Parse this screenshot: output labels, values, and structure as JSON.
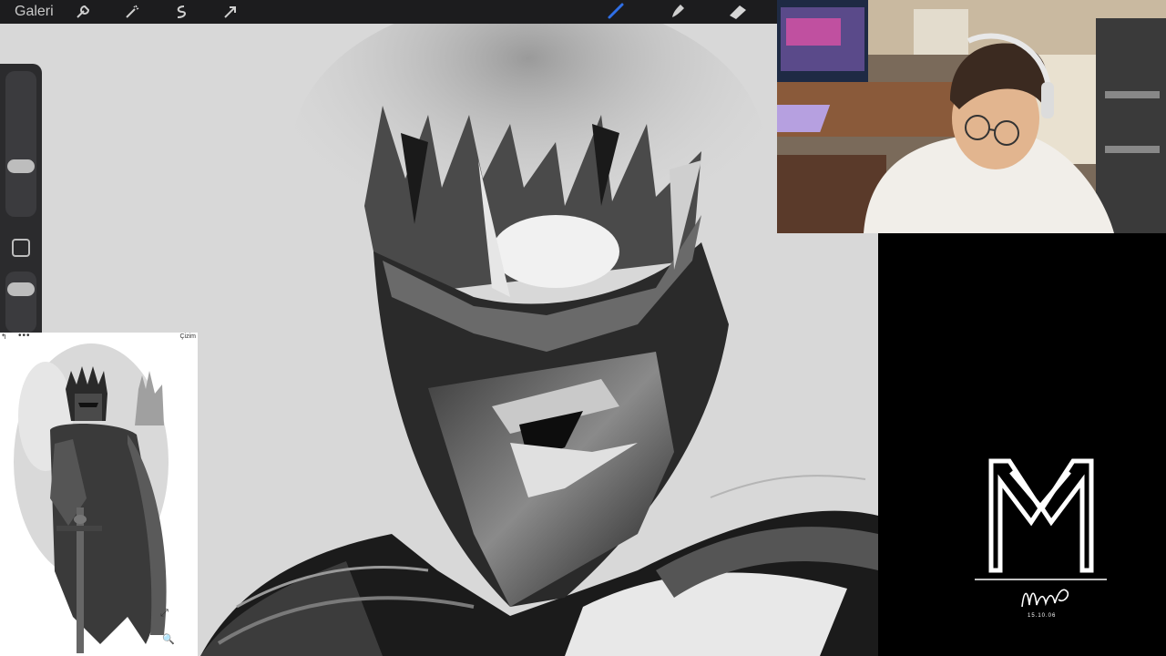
{
  "topbar": {
    "gallery_label": "Galeri",
    "tools": [
      {
        "name": "wrench-icon"
      },
      {
        "name": "magic-wand-icon"
      },
      {
        "name": "selection-icon"
      },
      {
        "name": "transform-arrow-icon"
      }
    ],
    "right_tools": [
      {
        "name": "brush-icon",
        "color": "#2f6fe6"
      },
      {
        "name": "smudge-icon"
      },
      {
        "name": "eraser-icon"
      }
    ]
  },
  "reference": {
    "title": "Çizim"
  },
  "signature": {
    "date": "15.10.06"
  },
  "colors": {
    "canvas_bg": "#d8d8d8",
    "toolbar_bg": "#1c1c1e",
    "sidebar_bg": "#2b2b2d",
    "accent": "#2f6fe6"
  }
}
